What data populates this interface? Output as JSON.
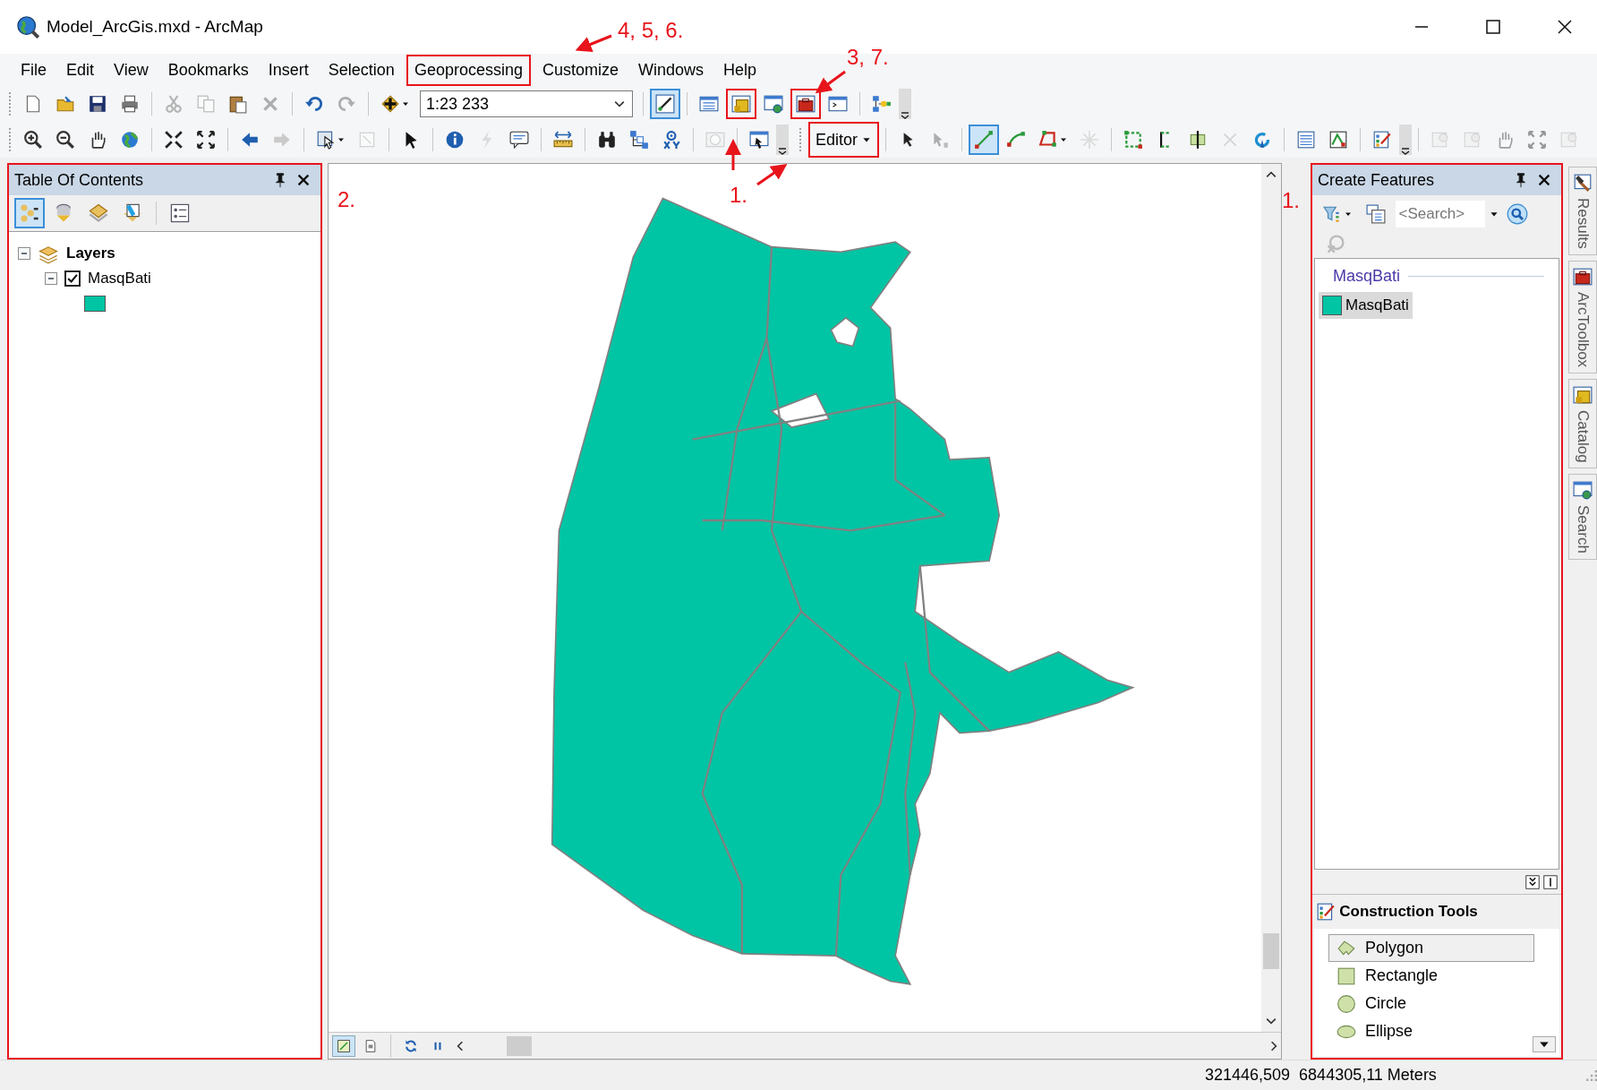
{
  "window": {
    "title": "Model_ArcGis.mxd - ArcMap"
  },
  "menu": [
    {
      "label": "File",
      "annotated": false
    },
    {
      "label": "Edit",
      "annotated": false
    },
    {
      "label": "View",
      "annotated": false
    },
    {
      "label": "Bookmarks",
      "annotated": false
    },
    {
      "label": "Insert",
      "annotated": false
    },
    {
      "label": "Selection",
      "annotated": false
    },
    {
      "label": "Geoprocessing",
      "annotated": true
    },
    {
      "label": "Customize",
      "annotated": false
    },
    {
      "label": "Windows",
      "annotated": false
    },
    {
      "label": "Help",
      "annotated": false
    }
  ],
  "toolbar_standard": [
    {
      "kind": "button",
      "disabled": false,
      "pressed": false,
      "annotated": false
    },
    {
      "kind": "button",
      "disabled": false,
      "pressed": false,
      "annotated": false
    },
    {
      "kind": "button",
      "disabled": false,
      "pressed": false,
      "annotated": false
    },
    {
      "kind": "button",
      "disabled": false,
      "pressed": false,
      "annotated": false
    },
    {
      "kind": "separator"
    },
    {
      "kind": "button",
      "disabled": true,
      "pressed": false,
      "annotated": false
    },
    {
      "kind": "button",
      "disabled": true,
      "pressed": false,
      "annotated": false
    },
    {
      "kind": "button",
      "disabled": false,
      "pressed": false,
      "annotated": false
    },
    {
      "kind": "button",
      "disabled": true,
      "pressed": false,
      "annotated": false
    },
    {
      "kind": "separator"
    },
    {
      "kind": "button",
      "disabled": false,
      "pressed": false,
      "annotated": false
    },
    {
      "kind": "button",
      "disabled": true,
      "pressed": false,
      "annotated": false
    },
    {
      "kind": "separator"
    },
    {
      "kind": "dropdown",
      "disabled": false,
      "pressed": false,
      "annotated": false
    },
    {
      "kind": "combo",
      "value": "1:23 233"
    },
    {
      "kind": "separator"
    },
    {
      "kind": "button",
      "disabled": false,
      "pressed": true,
      "annotated": false
    },
    {
      "kind": "separator"
    },
    {
      "kind": "button",
      "disabled": false,
      "pressed": false,
      "annotated": false
    },
    {
      "kind": "button",
      "disabled": false,
      "pressed": false,
      "annotated": true
    },
    {
      "kind": "button",
      "disabled": false,
      "pressed": false,
      "annotated": false
    },
    {
      "kind": "button",
      "disabled": false,
      "pressed": false,
      "annotated": true
    },
    {
      "kind": "button",
      "disabled": false,
      "pressed": false,
      "annotated": false
    },
    {
      "kind": "separator"
    },
    {
      "kind": "button",
      "disabled": false,
      "pressed": false,
      "annotated": false
    },
    {
      "kind": "overflow"
    }
  ],
  "toolbar_tools": [
    {
      "kind": "button",
      "disabled": false,
      "pressed": false,
      "annotated": false
    },
    {
      "kind": "button",
      "disabled": false,
      "pressed": false,
      "annotated": false
    },
    {
      "kind": "button",
      "disabled": false,
      "pressed": false,
      "annotated": false
    },
    {
      "kind": "button",
      "disabled": false,
      "pressed": false,
      "annotated": false
    },
    {
      "kind": "separator"
    },
    {
      "kind": "button",
      "disabled": false,
      "pressed": false,
      "annotated": false
    },
    {
      "kind": "button",
      "disabled": false,
      "pressed": false,
      "annotated": false
    },
    {
      "kind": "separator"
    },
    {
      "kind": "button",
      "disabled": false,
      "pressed": false,
      "annotated": false
    },
    {
      "kind": "button",
      "disabled": true,
      "pressed": false,
      "annotated": false
    },
    {
      "kind": "separator"
    },
    {
      "kind": "dropdown",
      "disabled": false,
      "pressed": false,
      "annotated": false
    },
    {
      "kind": "button",
      "disabled": true,
      "pressed": false,
      "annotated": false
    },
    {
      "kind": "separator"
    },
    {
      "kind": "button",
      "disabled": false,
      "pressed": false,
      "annotated": false
    },
    {
      "kind": "separator"
    },
    {
      "kind": "button",
      "disabled": false,
      "pressed": false,
      "annotated": false
    },
    {
      "kind": "button",
      "disabled": true,
      "pressed": false,
      "annotated": false
    },
    {
      "kind": "button",
      "disabled": false,
      "pressed": false,
      "annotated": false
    },
    {
      "kind": "separator"
    },
    {
      "kind": "button",
      "disabled": false,
      "pressed": false,
      "annotated": false
    },
    {
      "kind": "separator"
    },
    {
      "kind": "button",
      "disabled": false,
      "pressed": false,
      "annotated": false
    },
    {
      "kind": "button",
      "disabled": false,
      "pressed": false,
      "annotated": false
    },
    {
      "kind": "button",
      "disabled": false,
      "pressed": false,
      "annotated": false
    },
    {
      "kind": "separator"
    },
    {
      "kind": "button",
      "disabled": true,
      "pressed": false,
      "annotated": false
    },
    {
      "kind": "separator"
    },
    {
      "kind": "button",
      "disabled": false,
      "pressed": false,
      "annotated": false
    },
    {
      "kind": "overflow"
    }
  ],
  "toolbar_editor": [
    {
      "kind": "menu",
      "label": "Editor",
      "annotated": true
    },
    {
      "kind": "separator"
    },
    {
      "kind": "button",
      "disabled": false,
      "pressed": false,
      "annotated": false
    },
    {
      "kind": "button",
      "disabled": true,
      "pressed": false,
      "annotated": false
    },
    {
      "kind": "separator"
    },
    {
      "kind": "button",
      "disabled": false,
      "pressed": true,
      "annotated": false
    },
    {
      "kind": "button",
      "disabled": false,
      "pressed": false,
      "annotated": false
    },
    {
      "kind": "dropdown",
      "disabled": false,
      "pressed": false,
      "annotated": false
    },
    {
      "kind": "button",
      "disabled": true,
      "pressed": false,
      "annotated": false
    },
    {
      "kind": "separator"
    },
    {
      "kind": "button",
      "disabled": false,
      "pressed": false,
      "annotated": false
    },
    {
      "kind": "button",
      "disabled": false,
      "pressed": false,
      "annotated": false
    },
    {
      "kind": "button",
      "disabled": false,
      "pressed": false,
      "annotated": false
    },
    {
      "kind": "button",
      "disabled": true,
      "pressed": false,
      "annotated": false
    },
    {
      "kind": "button",
      "disabled": false,
      "pressed": false,
      "annotated": false
    },
    {
      "kind": "separator"
    },
    {
      "kind": "button",
      "disabled": false,
      "pressed": false,
      "annotated": false
    },
    {
      "kind": "button",
      "disabled": false,
      "pressed": false,
      "annotated": false
    },
    {
      "kind": "separator"
    },
    {
      "kind": "button",
      "disabled": false,
      "pressed": false,
      "annotated": false
    },
    {
      "kind": "overflow"
    },
    {
      "kind": "separator"
    },
    {
      "kind": "button",
      "disabled": true,
      "pressed": false,
      "annotated": false
    },
    {
      "kind": "button",
      "disabled": true,
      "pressed": false,
      "annotated": false
    },
    {
      "kind": "button",
      "disabled": true,
      "pressed": false,
      "annotated": false
    },
    {
      "kind": "button",
      "disabled": true,
      "pressed": false,
      "annotated": false
    },
    {
      "kind": "button",
      "disabled": true,
      "pressed": false,
      "annotated": false
    }
  ],
  "table_of_contents": {
    "title": "Table Of Contents",
    "annotated": true,
    "tools": [
      {
        "selected": true
      },
      {
        "selected": false
      },
      {
        "selected": false
      },
      {
        "selected": false
      },
      {
        "selected": false
      }
    ],
    "tree": [
      {
        "kind": "frame",
        "label": "Layers",
        "expanded": true,
        "children": [
          {
            "kind": "layer",
            "label": "MasqBati",
            "expanded": true,
            "checked": true,
            "color": "#00c5a5"
          }
        ]
      }
    ]
  },
  "map": {
    "annotation": "2.",
    "views": [
      {
        "selected": true
      },
      {
        "selected": false
      }
    ]
  },
  "create_features": {
    "title": "Create Features",
    "annotated": true,
    "search": {
      "placeholder": "<Search>"
    },
    "groups": [
      {
        "label": "MasqBati",
        "templates": [
          {
            "label": "MasqBati",
            "color": "#00c5a5",
            "selected": true
          }
        ]
      }
    ],
    "construction_tools": {
      "title": "Construction Tools",
      "items": [
        {
          "label": "Polygon",
          "kind": "polygon",
          "selected": true
        },
        {
          "label": "Rectangle",
          "kind": "rectangle",
          "selected": false
        },
        {
          "label": "Circle",
          "kind": "circle",
          "selected": false
        },
        {
          "label": "Ellipse",
          "kind": "ellipse",
          "selected": false
        }
      ]
    }
  },
  "side_tabs": [
    {
      "label": "Results"
    },
    {
      "label": "ArcToolbox"
    },
    {
      "label": "Catalog"
    },
    {
      "label": "Search"
    }
  ],
  "annotations": [
    {
      "text": "4, 5, 6."
    },
    {
      "text": "3, 7."
    },
    {
      "text": "1."
    },
    {
      "text": "1."
    }
  ],
  "status_bar": {
    "coordinates": "321446,509  6844305,11 Meters"
  }
}
